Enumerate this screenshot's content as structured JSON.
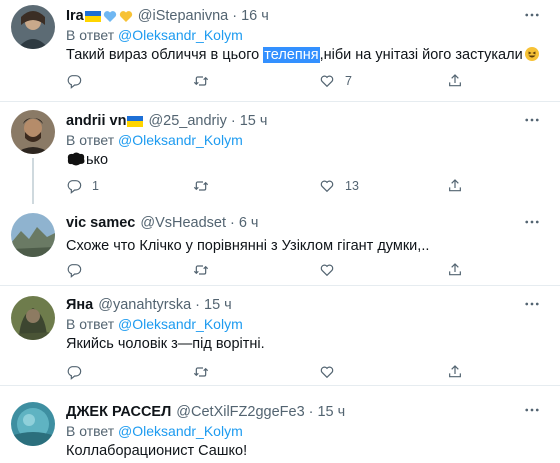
{
  "tweets": [
    {
      "name": "Ira",
      "handle": "@iStepanivna",
      "time": "16 ч",
      "reply_prefix": "В ответ",
      "reply_mention": "@Oleksandr_Kolym",
      "text_before": "Такий вираз обличчя в цього ",
      "text_highlight": "телепня",
      "text_after": ",ніби на унітазі його застукали",
      "replies": "",
      "likes": "7"
    },
    {
      "name": "andrii vn",
      "handle": "@25_andriy",
      "time": "15 ч",
      "reply_prefix": "В ответ",
      "reply_mention": "@Oleksandr_Kolym",
      "text": "ько",
      "replies": "1",
      "likes": "13"
    },
    {
      "name": "vic samec",
      "handle": "@VsHeadset",
      "time": "6 ч",
      "text": "Схоже что Клічко у порівнянні з Узіклом гігант думки,.."
    },
    {
      "name": "Яна",
      "handle": "@yanahtyrska",
      "time": "15 ч",
      "reply_prefix": "В ответ",
      "reply_mention": "@Oleksandr_Kolym",
      "text": "Якийсь чоловік з—під ворітні."
    },
    {
      "name": "ДЖЕК РАССЕЛ",
      "handle": "@CetXilFZ2ggeFe3",
      "time": "15 ч",
      "reply_prefix": "В ответ",
      "reply_mention": "@Oleksandr_Kolym",
      "text": "Коллаборационист  Сашко!"
    }
  ],
  "colors": {
    "link": "#1d9bf0",
    "muted": "#536471",
    "highlight": "#3390ff",
    "separator": "#e6ecf0"
  }
}
